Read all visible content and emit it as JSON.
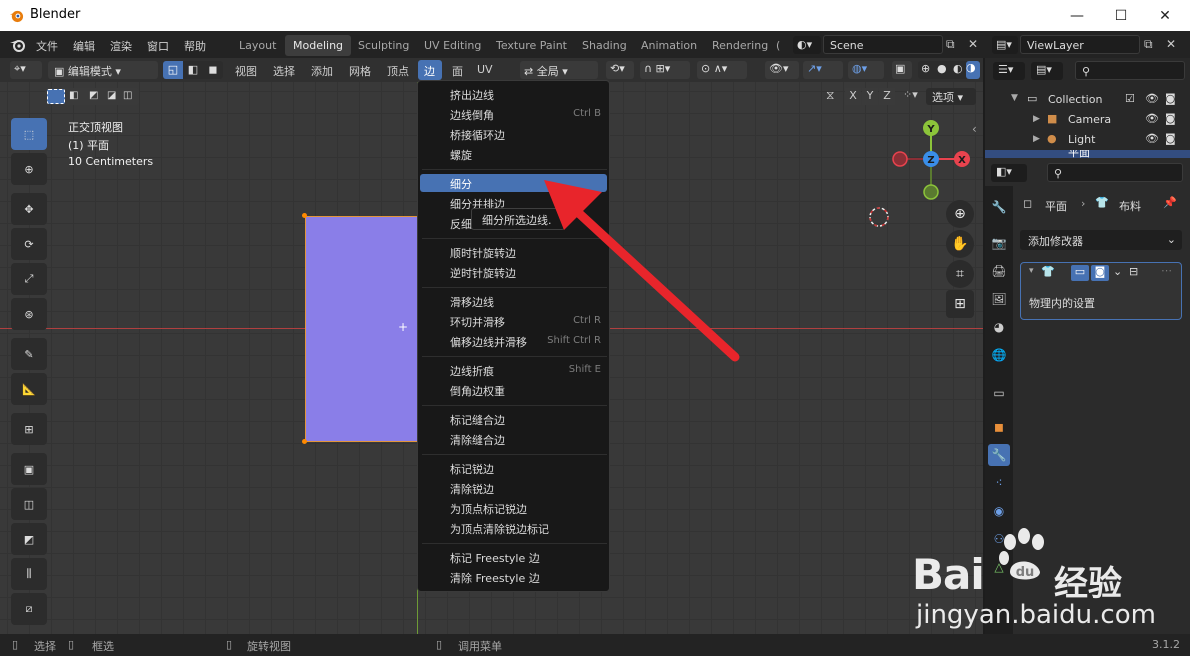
{
  "window": {
    "title": "Blender",
    "minimize": "—",
    "maximize": "☐",
    "close": "✕"
  },
  "menubar": [
    "文件",
    "编辑",
    "渲染",
    "窗口",
    "帮助"
  ],
  "workspace_tabs": [
    "Layout",
    "Modeling",
    "Sculpting",
    "UV Editing",
    "Texture Paint",
    "Shading",
    "Animation",
    "Rendering",
    "("
  ],
  "active_workspace": "Modeling",
  "scene_field": "Scene",
  "viewlayer_field": "ViewLayer",
  "header": {
    "mode": "编辑模式",
    "menus": [
      "视图",
      "选择",
      "添加",
      "网格",
      "顶点",
      "边",
      "面",
      "UV"
    ],
    "active_menu": "边",
    "transform_orientation": "全局",
    "options_label": "选项",
    "axes": [
      "X",
      "Y",
      "Z"
    ]
  },
  "viewport": {
    "view_name": "正交顶视图",
    "object_info": "(1) 平面",
    "scale_info": "10 Centimeters",
    "gizmo": {
      "y": "Y",
      "z": "Z",
      "x": "X"
    },
    "plane_color": "#8a7ee8"
  },
  "edge_menu": {
    "items": [
      {
        "label": "挤出边线",
        "shortcut": ""
      },
      {
        "label": "边线倒角",
        "shortcut": "Ctrl B"
      },
      {
        "label": "桥接循环边",
        "shortcut": ""
      },
      {
        "label": "螺旋",
        "shortcut": ""
      },
      {
        "label": "细分",
        "shortcut": "",
        "highlighted": true
      },
      {
        "label": "细分并排边",
        "shortcut": ""
      },
      {
        "label": "反细",
        "shortcut": ""
      },
      {
        "label": "顺时针旋转边",
        "shortcut": ""
      },
      {
        "label": "逆时针旋转边",
        "shortcut": ""
      },
      {
        "label": "滑移边线",
        "shortcut": ""
      },
      {
        "label": "环切并滑移",
        "shortcut": "Ctrl R"
      },
      {
        "label": "偏移边线并滑移",
        "shortcut": "Shift Ctrl R"
      },
      {
        "label": "边线折痕",
        "shortcut": "Shift E"
      },
      {
        "label": "倒角边权重",
        "shortcut": ""
      },
      {
        "label": "标记缝合边",
        "shortcut": ""
      },
      {
        "label": "清除缝合边",
        "shortcut": ""
      },
      {
        "label": "标记锐边",
        "shortcut": ""
      },
      {
        "label": "清除锐边",
        "shortcut": ""
      },
      {
        "label": "为顶点标记锐边",
        "shortcut": ""
      },
      {
        "label": "为顶点清除锐边标记",
        "shortcut": ""
      },
      {
        "label": "标记 Freestyle 边",
        "shortcut": ""
      },
      {
        "label": "清除 Freestyle 边",
        "shortcut": ""
      }
    ],
    "tooltip": "细分所选边线."
  },
  "outliner": {
    "collection": "Collection",
    "items": [
      "Camera",
      "Light",
      "平面"
    ]
  },
  "properties": {
    "breadcrumb_object": "平面",
    "breadcrumb_modifier": "布料",
    "add_modifier": "添加修改器",
    "modifier_text": "物理内的设置"
  },
  "statusbar": {
    "items": [
      "选择",
      "框选",
      "旋转视图",
      "调用菜单"
    ],
    "version": "3.1.2"
  },
  "watermark": {
    "brand": "Bai",
    "brand2": "经验",
    "url": "jingyan.baidu.com"
  },
  "colors": {
    "accent": "#4772b3",
    "arrow": "#e8252b",
    "x_axis": "#e8434e",
    "y_axis": "#8cc43a",
    "z_axis": "#3a8ee8"
  }
}
